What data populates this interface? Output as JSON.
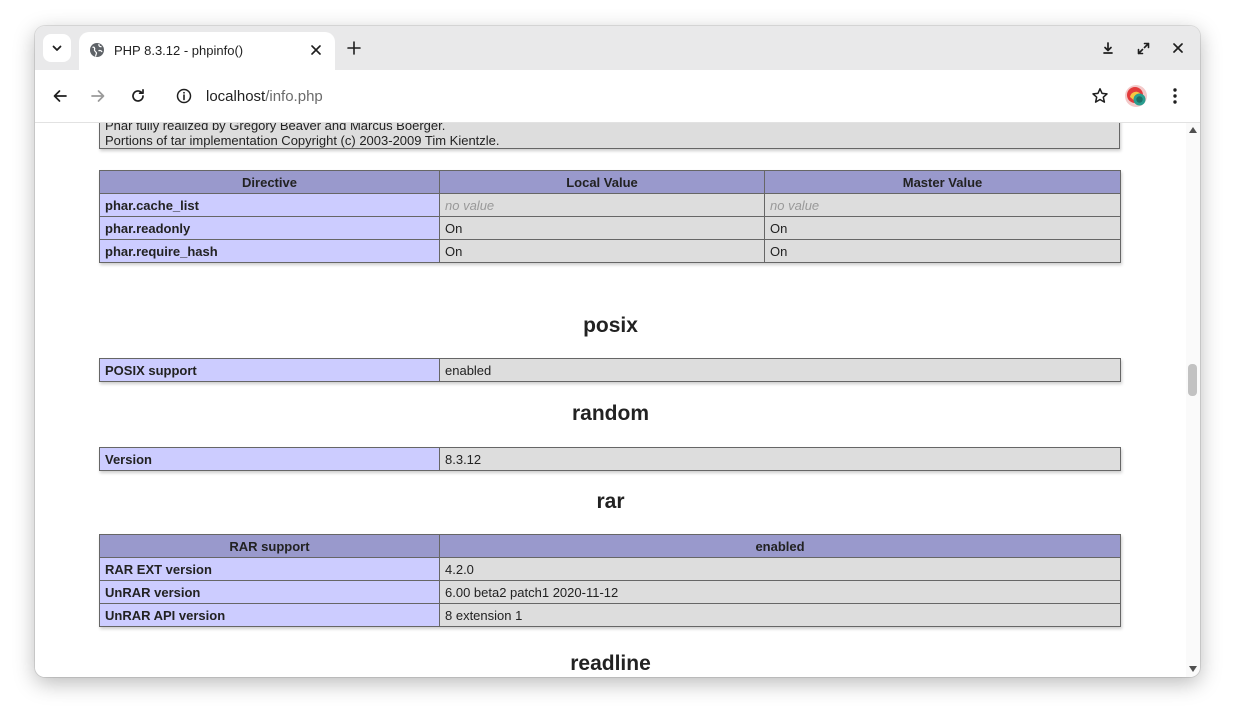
{
  "browser": {
    "tab_title": "PHP 8.3.12 - phpinfo()",
    "url_host": "localhost",
    "url_path": "/info.php"
  },
  "credits": {
    "line1": "Phar fully realized by Gregory Beaver and Marcus Boerger.",
    "line2": "Portions of tar implementation Copyright (c) 2003-2009 Tim Kientzle."
  },
  "phar": {
    "headers": [
      "Directive",
      "Local Value",
      "Master Value"
    ],
    "rows": [
      {
        "name": "phar.cache_list",
        "local": "no value",
        "master": "no value"
      },
      {
        "name": "phar.readonly",
        "local": "On",
        "master": "On"
      },
      {
        "name": "phar.require_hash",
        "local": "On",
        "master": "On"
      }
    ]
  },
  "posix": {
    "title": "posix",
    "rows": [
      {
        "name": "POSIX support",
        "value": "enabled"
      }
    ]
  },
  "random": {
    "title": "random",
    "rows": [
      {
        "name": "Version",
        "value": "8.3.12"
      }
    ]
  },
  "rar": {
    "title": "rar",
    "header": [
      "RAR support",
      "enabled"
    ],
    "rows": [
      {
        "name": "RAR EXT version",
        "value": "4.2.0"
      },
      {
        "name": "UnRAR version",
        "value": "6.00 beta2 patch1 2020-11-12"
      },
      {
        "name": "UnRAR API version",
        "value": "8 extension 1"
      }
    ]
  },
  "readline": {
    "title": "readline"
  },
  "colors": {
    "header_bg": "#9999cc",
    "key_bg": "#ccccff",
    "value_bg": "#dddddd"
  }
}
